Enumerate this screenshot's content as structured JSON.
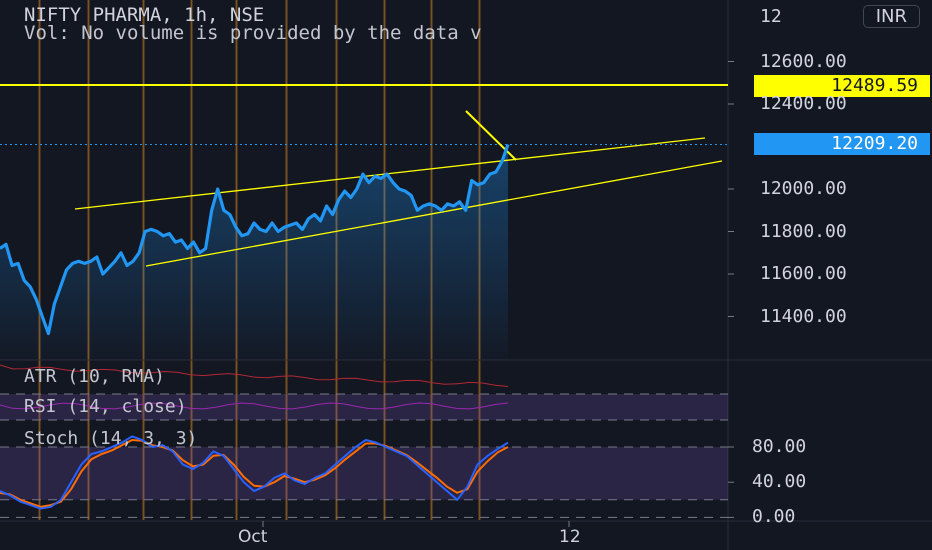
{
  "header": {
    "title": "NIFTY PHARMA, 1h, NSE",
    "volume_note": "Vol: No volume is provided by the data v"
  },
  "currency": "INR",
  "price_tags": {
    "resistance": "12489.59",
    "last": "12209.20"
  },
  "indicators": {
    "atr": "ATR (10, RMA)",
    "rsi": "RSI (14, close)",
    "stoch": "Stoch (14, 3, 3)"
  },
  "colors": {
    "background": "#131722",
    "price_line": "#2196f3",
    "trendline": "#ffff00",
    "stoch_k": "#2962ff",
    "stoch_d": "#ff6d00",
    "stoch_band": "#7e57c2",
    "atr_line": "#b22833"
  },
  "chart_data": [
    {
      "type": "line",
      "xlabels": [
        "Oct",
        "12"
      ],
      "yticks": [
        "12600.00",
        "12400.00",
        "12000.00",
        "11800.00",
        "11600.00",
        "11400.00"
      ],
      "ylim": [
        11300,
        12800
      ],
      "series": [
        {
          "values": [
            11720,
            11740,
            11640,
            11650,
            11570,
            11540,
            11480,
            11400,
            11320,
            11460,
            11540,
            11620,
            11650,
            11660,
            11650,
            11660,
            11680,
            11600,
            11630,
            11660,
            11700,
            11640,
            11660,
            11700,
            11800,
            11810,
            11800,
            11780,
            11790,
            11750,
            11760,
            11720,
            11750,
            11700,
            11720,
            11900,
            12000,
            11900,
            11880,
            11820,
            11780,
            11790,
            11840,
            11810,
            11800,
            11840,
            11800,
            11820,
            11830,
            11840,
            11810,
            11860,
            11880,
            11850,
            11920,
            11880,
            11950,
            11990,
            11960,
            12000,
            12070,
            12030,
            12060,
            12050,
            12070,
            12030,
            12000,
            11990,
            11970,
            11900,
            11920,
            11930,
            11920,
            11900,
            11930,
            11920,
            11940,
            11900,
            12040,
            12020,
            12030,
            12070,
            12080,
            12130,
            12209.2
          ]
        }
      ],
      "resistance_level": 12489.59,
      "last_price": 12209.2
    },
    {
      "type": "line",
      "title": "Stoch (14, 3, 3)",
      "yticks": [
        "80.00",
        "40.00",
        "0.00"
      ],
      "ylim": [
        0,
        100
      ],
      "band": [
        20,
        80
      ],
      "series": [
        {
          "values": [
            30,
            25,
            18,
            14,
            10,
            12,
            20,
            40,
            60,
            72,
            75,
            80,
            85,
            92,
            88,
            80,
            82,
            75,
            60,
            55,
            62,
            75,
            70,
            55,
            40,
            30,
            35,
            45,
            50,
            42,
            38,
            45,
            50,
            60,
            70,
            80,
            88,
            85,
            80,
            75,
            70,
            60,
            50,
            40,
            30,
            20,
            35,
            60,
            70,
            78,
            85
          ]
        },
        {
          "values": [
            28,
            26,
            20,
            16,
            12,
            14,
            18,
            32,
            52,
            66,
            72,
            76,
            82,
            88,
            87,
            82,
            80,
            76,
            65,
            58,
            60,
            70,
            71,
            60,
            46,
            36,
            35,
            40,
            47,
            44,
            40,
            43,
            48,
            56,
            66,
            75,
            84,
            84,
            81,
            76,
            71,
            63,
            54,
            45,
            35,
            28,
            32,
            52,
            64,
            74,
            80
          ]
        }
      ]
    }
  ]
}
